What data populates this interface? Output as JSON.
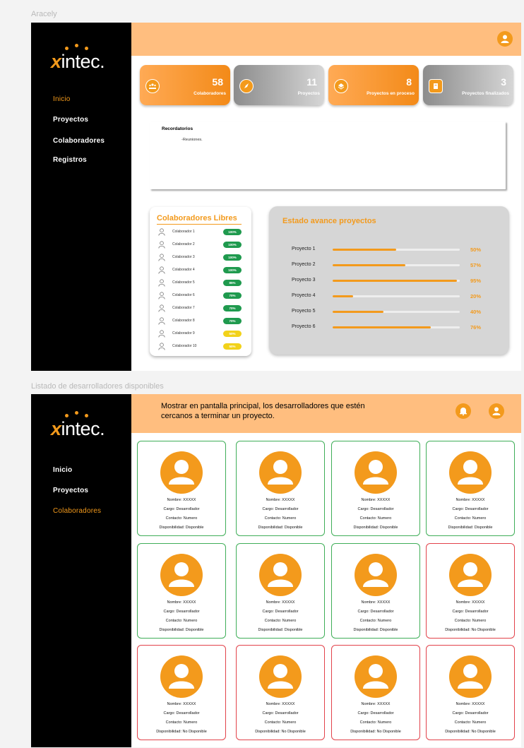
{
  "frame1": {
    "label": "Aracely",
    "logo": "xintec.",
    "nav": [
      "Inicio",
      "Proyectos",
      "Colaboradores",
      "Registros"
    ],
    "stats": [
      {
        "number": "58",
        "label": "Colaboradores",
        "icon": "team-icon"
      },
      {
        "number": "11",
        "label": "Proyectos",
        "icon": "rocket-icon"
      },
      {
        "number": "8",
        "label": "Proyectos en proceso",
        "icon": "layers-icon"
      },
      {
        "number": "3",
        "label": "Proyectos finalizados",
        "icon": "archive-icon"
      }
    ],
    "reminders": {
      "title": "Recordatorios",
      "items": [
        "-Reuniones."
      ]
    },
    "collaborators": {
      "title": "Colaboradores Libres",
      "rows": [
        {
          "name": "Colaborador 1",
          "value": "100%",
          "color": "#1f9a4e"
        },
        {
          "name": "Colaborador 2",
          "value": "100%",
          "color": "#1f9a4e"
        },
        {
          "name": "Colaborador 3",
          "value": "100%",
          "color": "#1f9a4e"
        },
        {
          "name": "Colaborador 4",
          "value": "100%",
          "color": "#1f9a4e"
        },
        {
          "name": "Colaborador 5",
          "value": "85%",
          "color": "#1f9a4e"
        },
        {
          "name": "Colaborador 6",
          "value": "70%",
          "color": "#1f9a4e"
        },
        {
          "name": "Colaborador 7",
          "value": "70%",
          "color": "#1f9a4e"
        },
        {
          "name": "Colaborador 8",
          "value": "70%",
          "color": "#1f9a4e"
        },
        {
          "name": "Colaborador 9",
          "value": "50%",
          "color": "#f2d21a"
        },
        {
          "name": "Colaborador 10",
          "value": "50%",
          "color": "#f2d21a"
        }
      ]
    },
    "progress": {
      "title": "Estado avance proyectos",
      "rows": [
        {
          "name": "Proyecto 1",
          "label": "50%",
          "value": 0.5
        },
        {
          "name": "Proyecto 2",
          "label": "57%",
          "value": 0.57
        },
        {
          "name": "Proyecto 3",
          "label": "95%",
          "value": 0.98
        },
        {
          "name": "Proyecto 4",
          "label": "20%",
          "value": 0.16
        },
        {
          "name": "Proyecto 5",
          "label": "40%",
          "value": 0.4
        },
        {
          "name": "Proyecto 6",
          "label": "76%",
          "value": 0.77
        }
      ]
    }
  },
  "frame2": {
    "label": "Listado de desarrolladores disponibles",
    "logo": "xintec.",
    "nav": [
      "Inicio",
      "Proyectos",
      "Colaboradores"
    ],
    "message": "Mostrar en pantalla principal, los desarrolladores que estén cercanos a terminar un proyecto.",
    "cards": [
      {
        "nombre": "Nombre: XXXXX",
        "cargo": "Cargo: Desarrollador",
        "contacto": "Contacto: Numero",
        "disp": "Disponibilidad: Disponible",
        "available": true
      },
      {
        "nombre": "Nombre: XXXXX",
        "cargo": "Cargo: Desarrollador",
        "contacto": "Contacto: Numero",
        "disp": "Disponibilidad: Disponible",
        "available": true
      },
      {
        "nombre": "Nombre: XXXXX",
        "cargo": "Cargo: Desarrollador",
        "contacto": "Contacto: Numero",
        "disp": "Disponibilidad: Disponible",
        "available": true
      },
      {
        "nombre": "Nombre: XXXXX",
        "cargo": "Cargo: Desarrollador",
        "contacto": "Contacto: Numero",
        "disp": "Disponibilidad: Disponible",
        "available": true
      },
      {
        "nombre": "Nombre: XXXXX",
        "cargo": "Cargo: Desarrollador",
        "contacto": "Contacto: Numero",
        "disp": "Disponibilidad: Disponible",
        "available": true
      },
      {
        "nombre": "Nombre: XXXXX",
        "cargo": "Cargo: Desarrollador",
        "contacto": "Contacto: Numero",
        "disp": "Disponibilidad: Disponible",
        "available": true
      },
      {
        "nombre": "Nombre: XXXXX",
        "cargo": "Cargo: Desarrollador",
        "contacto": "Contacto: Numero",
        "disp": "Disponibilidad: Disponible",
        "available": true
      },
      {
        "nombre": "Nombre: XXXXX",
        "cargo": "Cargo: Desarrollador",
        "contacto": "Contacto: Numero",
        "disp": "Disponibilidad: No Disponible",
        "available": false
      },
      {
        "nombre": "Nombre: XXXXX",
        "cargo": "Cargo: Desarrollador",
        "contacto": "Contacto: Numero",
        "disp": "Disponibilidad: No Disponible",
        "available": false
      },
      {
        "nombre": "Nombre: XXXXX",
        "cargo": "Cargo: Desarrollador",
        "contacto": "Contacto: Numero",
        "disp": "Disponibilidad: No Disponible",
        "available": false
      },
      {
        "nombre": "Nombre: XXXXX",
        "cargo": "Cargo: Desarrollador",
        "contacto": "Contacto: Numero",
        "disp": "Disponibilidad: No Disponible",
        "available": false
      },
      {
        "nombre": "Nombre: XXXXX",
        "cargo": "Cargo: Desarrollador",
        "contacto": "Contacto: Numero",
        "disp": "Disponibilidad: No Disponible",
        "available": false
      }
    ]
  },
  "colors": {
    "accent": "#f39a1c",
    "topbar": "#ffbe7f",
    "available": "#3fae58",
    "unavailable": "#e2424a"
  }
}
